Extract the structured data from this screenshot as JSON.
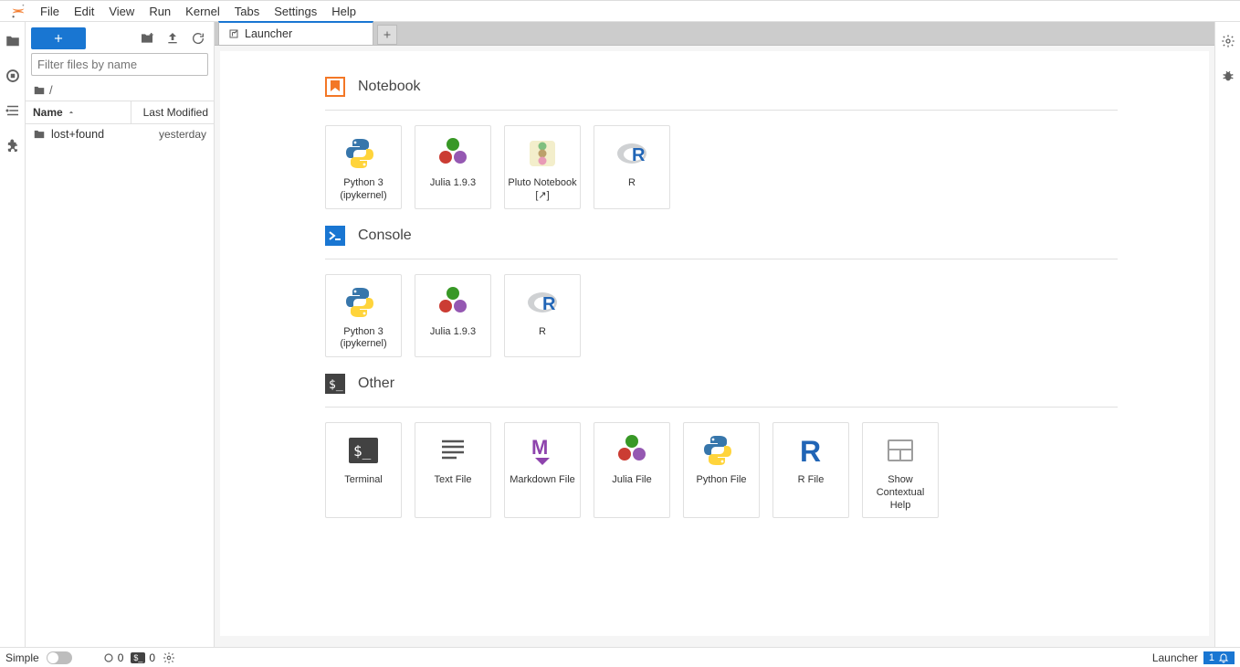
{
  "menu": [
    "File",
    "Edit",
    "View",
    "Run",
    "Kernel",
    "Tabs",
    "Settings",
    "Help"
  ],
  "filebrowser": {
    "search_placeholder": "Filter files by name",
    "breadcrumb_root": "/",
    "col_name": "Name",
    "col_modified": "Last Modified",
    "items": [
      {
        "name": "lost+found",
        "modified": "yesterday"
      }
    ]
  },
  "tab": {
    "title": "Launcher"
  },
  "sections": {
    "notebook": {
      "title": "Notebook",
      "cards": [
        {
          "label": "Python 3 (ipykernel)",
          "icon": "python"
        },
        {
          "label": "Julia 1.9.3",
          "icon": "julia"
        },
        {
          "label": "Pluto Notebook [↗]",
          "icon": "pluto"
        },
        {
          "label": "R",
          "icon": "r"
        }
      ]
    },
    "console": {
      "title": "Console",
      "cards": [
        {
          "label": "Python 3 (ipykernel)",
          "icon": "python"
        },
        {
          "label": "Julia 1.9.3",
          "icon": "julia"
        },
        {
          "label": "R",
          "icon": "r"
        }
      ]
    },
    "other": {
      "title": "Other",
      "cards": [
        {
          "label": "Terminal",
          "icon": "terminal"
        },
        {
          "label": "Text File",
          "icon": "text"
        },
        {
          "label": "Markdown File",
          "icon": "markdown"
        },
        {
          "label": "Julia File",
          "icon": "julia"
        },
        {
          "label": "Python File",
          "icon": "python"
        },
        {
          "label": "R File",
          "icon": "r-letter"
        },
        {
          "label": "Show Contextual Help",
          "icon": "help"
        }
      ]
    }
  },
  "status": {
    "simple": "Simple",
    "kernels": "0",
    "terminals": "0",
    "right_label": "Launcher",
    "notif_count": "1"
  }
}
